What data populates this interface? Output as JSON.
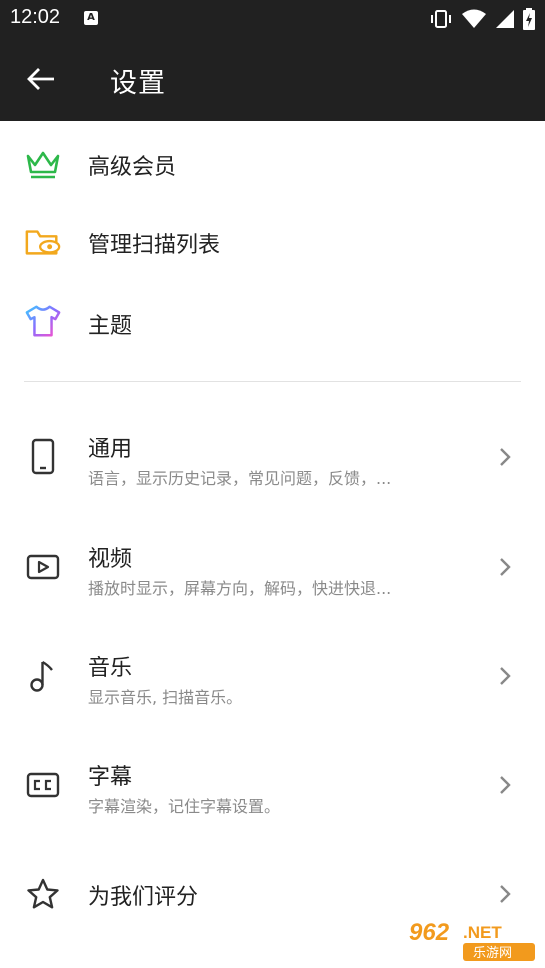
{
  "status": {
    "time": "12:02",
    "notification_badge": "A"
  },
  "appbar": {
    "title": "设置"
  },
  "top_items": [
    {
      "label": "高级会员",
      "icon": "crown-icon"
    },
    {
      "label": "管理扫描列表",
      "icon": "folder-eye-icon"
    },
    {
      "label": "主题",
      "icon": "tshirt-icon"
    }
  ],
  "settings": [
    {
      "label": "通用",
      "sub": "语言，显示历史记录，常见问题，反馈，...",
      "icon": "phone-icon"
    },
    {
      "label": "视频",
      "sub": "播放时显示，屏幕方向，解码，快进快退...",
      "icon": "video-icon"
    },
    {
      "label": "音乐",
      "sub": "显示音乐, 扫描音乐。",
      "icon": "music-note-icon"
    },
    {
      "label": "字幕",
      "sub": "字幕渲染，记住字幕设置。",
      "icon": "cc-icon"
    },
    {
      "label": "为我们评分",
      "icon": "star-icon"
    }
  ],
  "watermark": {
    "text_top": "962.NET",
    "text_bottom": "乐游网"
  },
  "colors": {
    "bar": "#212121",
    "crown": "#2db84a",
    "folder": "#f2a81d",
    "icon_gray": "#333333"
  }
}
